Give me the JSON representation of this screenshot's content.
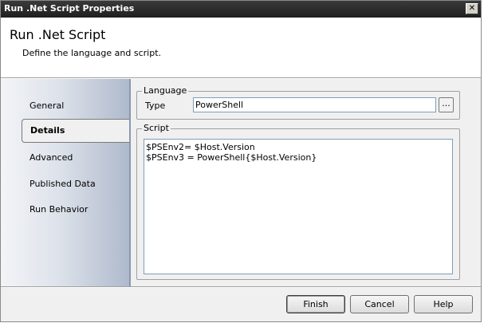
{
  "window": {
    "title": "Run .Net Script Properties",
    "close_glyph": "✕"
  },
  "header": {
    "title": "Run .Net Script",
    "subtitle": "Define the language and script."
  },
  "sidebar": {
    "items": [
      {
        "label": "General"
      },
      {
        "label": "Details"
      },
      {
        "label": "Advanced"
      },
      {
        "label": "Published Data"
      },
      {
        "label": "Run Behavior"
      }
    ],
    "selected": "Details"
  },
  "language_group": {
    "label": "Language",
    "type_label": "Type",
    "type_value": "PowerShell",
    "browse_label": "..."
  },
  "script_group": {
    "label": "Script",
    "lines": [
      "$PSEnv2= $Host.Version",
      "$PSEnv3 = PowerShell{$Host.Version}"
    ]
  },
  "footer": {
    "finish_label": "Finish",
    "cancel_label": "Cancel",
    "help_label": "Help"
  },
  "colors": {
    "titlebar": "#2a2a2a",
    "sidebar_gradient_end": "#aeb9cc",
    "input_border": "#7f9db9"
  }
}
